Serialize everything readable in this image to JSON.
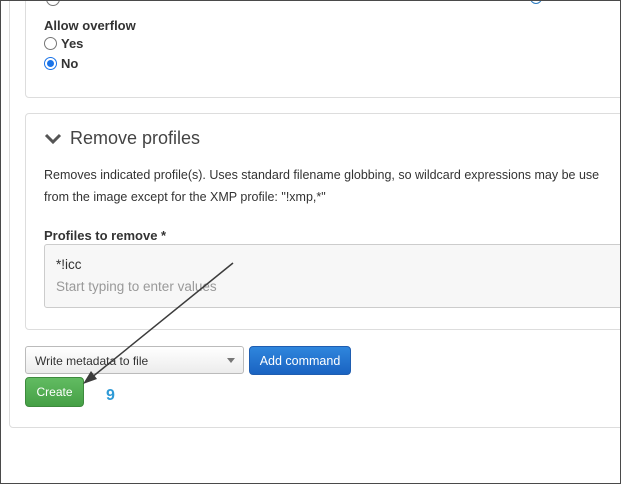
{
  "overflow_section": {
    "label": "Allow overflow",
    "options": [
      {
        "label": "Yes",
        "checked": false
      },
      {
        "label": "No",
        "checked": true
      }
    ]
  },
  "remove_profiles": {
    "title": "Remove profiles",
    "description_line1": "Removes indicated profile(s). Uses standard filename globbing, so wildcard expressions may be use",
    "description_line2": "from the image except for the XMP profile: \"!xmp,*\"",
    "profiles_label": "Profiles to remove *",
    "tag_value": "*!icc",
    "placeholder": "Start typing to enter values"
  },
  "command_bar": {
    "select_value": "Write metadata to file",
    "add_button": "Add command",
    "create_button": "Create"
  },
  "annotation": {
    "step_number": "9"
  },
  "colors": {
    "accent_blue": "#1a63c2",
    "create_green": "#45a045",
    "step_number": "#2e9ad6",
    "radio_checked": "#1a73e8"
  }
}
